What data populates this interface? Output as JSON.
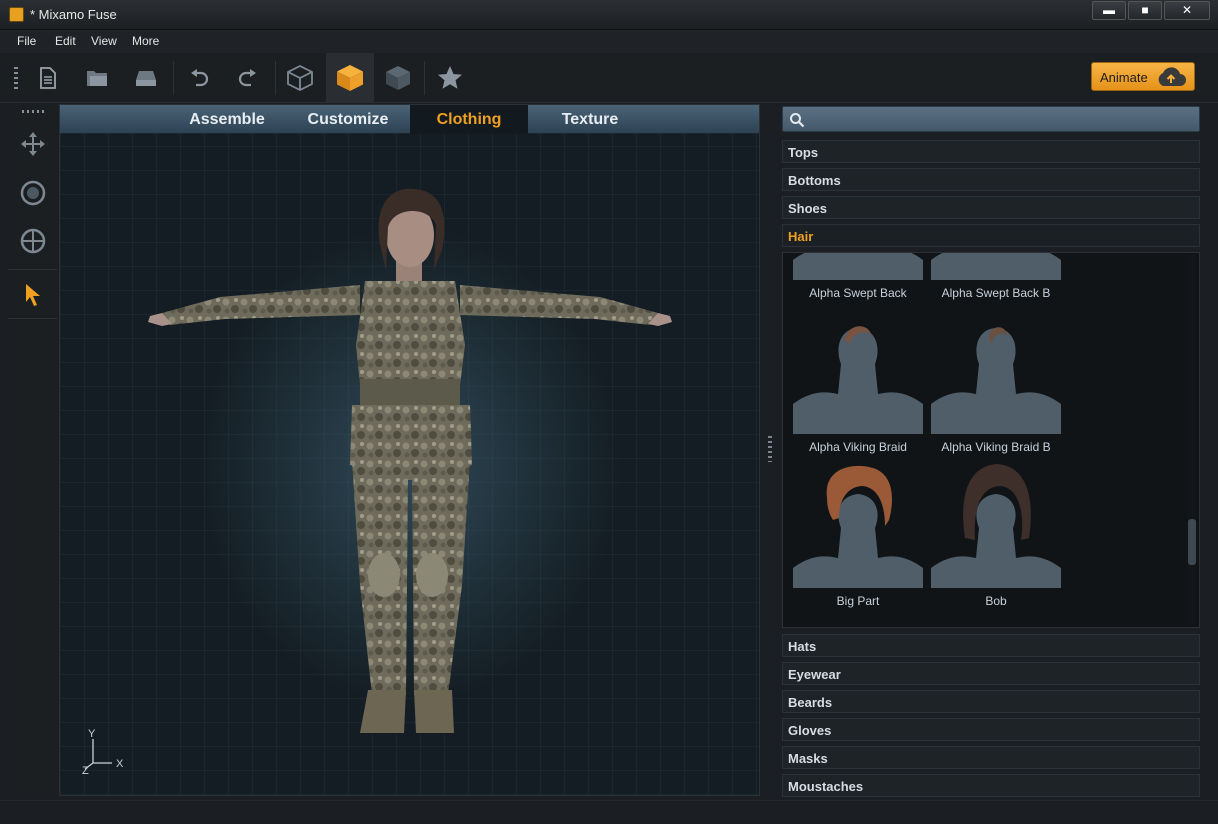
{
  "window": {
    "title": "* Mixamo Fuse",
    "minimize": "▬",
    "maximize": "■",
    "close": "✕"
  },
  "menu": [
    "File",
    "Edit",
    "View",
    "More"
  ],
  "toolbar": {
    "buttons": [
      "new-file-icon",
      "open-folder-icon",
      "save-icon",
      "undo-icon",
      "redo-icon",
      "box-outline-icon",
      "box-filled-icon",
      "box-dark-icon",
      "star-icon"
    ],
    "active": "box-filled-icon"
  },
  "animate": {
    "label": "Animate"
  },
  "left_tools": [
    "move-icon",
    "rotate-icon",
    "target-icon",
    "pointer-icon"
  ],
  "tabs": [
    {
      "label": "Assemble",
      "active": false
    },
    {
      "label": "Customize",
      "active": false
    },
    {
      "label": "Clothing",
      "active": true
    },
    {
      "label": "Texture",
      "active": false
    }
  ],
  "axis": {
    "y": "Y",
    "x": "X",
    "z": "Z"
  },
  "search": {
    "placeholder": "",
    "value": ""
  },
  "categories_top": [
    {
      "label": "Tops"
    },
    {
      "label": "Bottoms"
    },
    {
      "label": "Shoes"
    },
    {
      "label": "Hair",
      "active": true
    }
  ],
  "hair_items": [
    {
      "label": "Alpha Swept Back",
      "hair_color": "#4a5560"
    },
    {
      "label": "Alpha Swept Back B",
      "hair_color": "#4a5560"
    },
    {
      "label": "Alpha Viking Braid",
      "hair_color": "#7a5440"
    },
    {
      "label": "Alpha Viking Braid B",
      "hair_color": "#6a5040"
    },
    {
      "label": "Big Part",
      "hair_color": "#9a5a38"
    },
    {
      "label": "Bob",
      "hair_color": "#3e2f2a"
    }
  ],
  "categories_bottom": [
    {
      "label": "Hats"
    },
    {
      "label": "Eyewear"
    },
    {
      "label": "Beards"
    },
    {
      "label": "Gloves"
    },
    {
      "label": "Masks"
    },
    {
      "label": "Moustaches"
    }
  ],
  "colors": {
    "accent": "#f0a020",
    "panel": "#1e2327",
    "bust": "#4f5e69"
  }
}
